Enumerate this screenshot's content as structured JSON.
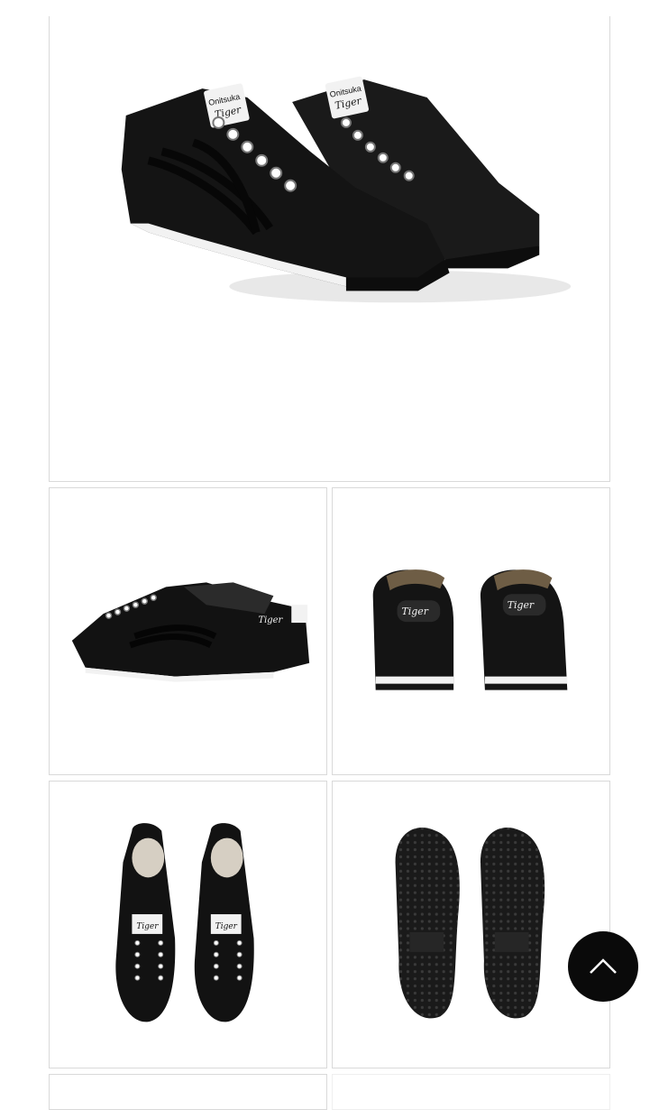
{
  "gallery": {
    "main_image": {
      "alt": "Black slip-on sneakers, front three-quarter view",
      "brand_tag_top": "Onitsuka",
      "brand_tag_script": "Tiger"
    },
    "thumbnails": [
      {
        "view": "side",
        "script": "Tiger"
      },
      {
        "view": "back",
        "script": "Tiger"
      },
      {
        "view": "top",
        "script": "Tiger"
      },
      {
        "view": "sole"
      }
    ]
  },
  "colors": {
    "shoe": "#141414",
    "sole_stripe": "#f2f2f2",
    "background": "#ffffff",
    "button": "#0a0a0a"
  },
  "scroll_top": {
    "icon": "chevron-up-icon"
  }
}
